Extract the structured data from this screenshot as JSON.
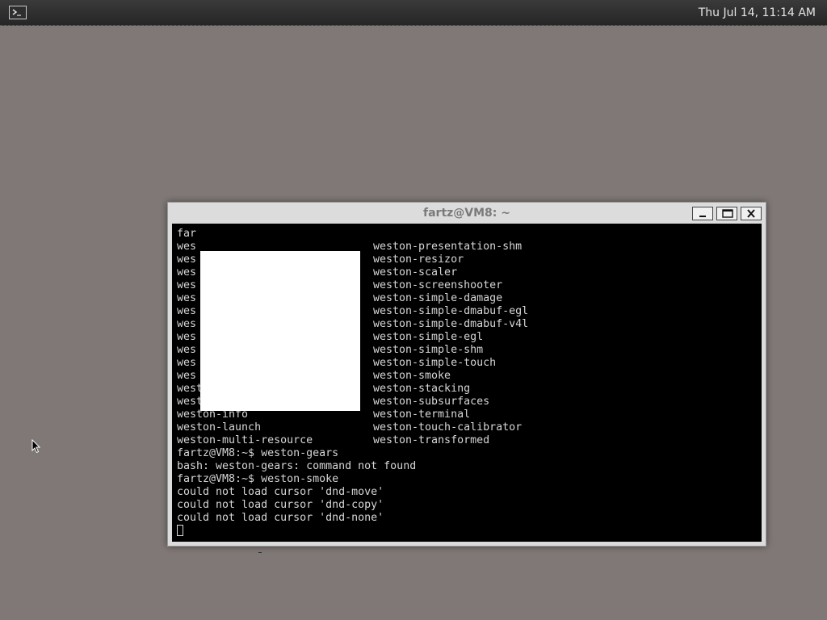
{
  "panel": {
    "launcher_icon": "terminal-icon",
    "clock": "Thu Jul 14, 11:14 AM"
  },
  "window": {
    "title": "fartz@VM8: ~",
    "buttons": {
      "minimize_icon": "minimize-icon",
      "maximize_icon": "maximize-icon",
      "close_icon": "close-icon"
    }
  },
  "terminal": {
    "lines": [
      {
        "c1": "far",
        "c2": ""
      },
      {
        "c1": "wes",
        "c2": "weston-presentation-shm"
      },
      {
        "c1": "wes",
        "c2": "weston-resizor"
      },
      {
        "c1": "wes",
        "c2": "weston-scaler"
      },
      {
        "c1": "wes",
        "c2": "weston-screenshooter"
      },
      {
        "c1": "wes",
        "c2": "weston-simple-damage"
      },
      {
        "c1": "wes",
        "c2": "weston-simple-dmabuf-egl"
      },
      {
        "c1": "wes",
        "c2": "weston-simple-dmabuf-v4l"
      },
      {
        "c1": "wes",
        "c2": "weston-simple-egl"
      },
      {
        "c1": "wes",
        "c2": "weston-simple-shm"
      },
      {
        "c1": "wes",
        "c2": "weston-simple-touch"
      },
      {
        "c1": "wes",
        "c2": "weston-smoke"
      },
      {
        "c1": "weston-fullscreen",
        "c2": "weston-stacking"
      },
      {
        "c1": "weston-image",
        "c2": "weston-subsurfaces"
      },
      {
        "c1": "weston-info",
        "c2": "weston-terminal"
      },
      {
        "c1": "weston-launch",
        "c2": "weston-touch-calibrator"
      },
      {
        "c1": "weston-multi-resource",
        "c2": "weston-transformed"
      },
      {
        "c1": "fartz@VM8:~$ weston-gears",
        "c2": ""
      },
      {
        "c1": "bash: weston-gears: command not found",
        "c2": ""
      },
      {
        "c1": "fartz@VM8:~$ weston-smoke",
        "c2": ""
      },
      {
        "c1": "could not load cursor 'dnd-move'",
        "c2": ""
      },
      {
        "c1": "could not load cursor 'dnd-copy'",
        "c2": ""
      },
      {
        "c1": "could not load cursor 'dnd-none'",
        "c2": ""
      }
    ]
  },
  "colors": {
    "desktop": "#7f7876",
    "panel": "#2f2f2f",
    "terminal_bg": "#000000",
    "terminal_fg": "#d6d6d6",
    "overlay": "#ffffff"
  }
}
